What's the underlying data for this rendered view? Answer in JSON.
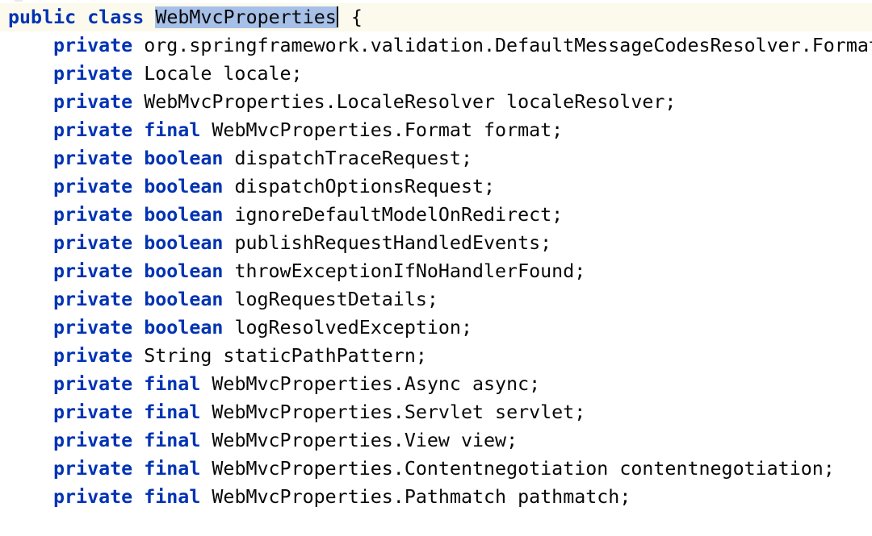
{
  "editor": {
    "class_decl": {
      "modifier": "public",
      "keyword": "class",
      "name": "WebMvcProperties",
      "brace": "{"
    },
    "fields": [
      {
        "access": "private",
        "qualifier": "",
        "decl": "org.springframework.validation.DefaultMessageCodesResolver.Format"
      },
      {
        "access": "private",
        "qualifier": "",
        "decl": "Locale locale;"
      },
      {
        "access": "private",
        "qualifier": "",
        "decl": "WebMvcProperties.LocaleResolver localeResolver;"
      },
      {
        "access": "private",
        "qualifier": "final",
        "decl": "WebMvcProperties.Format format;"
      },
      {
        "access": "private",
        "qualifier": "boolean",
        "decl": "dispatchTraceRequest;"
      },
      {
        "access": "private",
        "qualifier": "boolean",
        "decl": "dispatchOptionsRequest;"
      },
      {
        "access": "private",
        "qualifier": "boolean",
        "decl": "ignoreDefaultModelOnRedirect;"
      },
      {
        "access": "private",
        "qualifier": "boolean",
        "decl": "publishRequestHandledEvents;"
      },
      {
        "access": "private",
        "qualifier": "boolean",
        "decl": "throwExceptionIfNoHandlerFound;"
      },
      {
        "access": "private",
        "qualifier": "boolean",
        "decl": "logRequestDetails;"
      },
      {
        "access": "private",
        "qualifier": "boolean",
        "decl": "logResolvedException;"
      },
      {
        "access": "private",
        "qualifier": "",
        "decl": "String staticPathPattern;"
      },
      {
        "access": "private",
        "qualifier": "final",
        "decl": "WebMvcProperties.Async async;"
      },
      {
        "access": "private",
        "qualifier": "final",
        "decl": "WebMvcProperties.Servlet servlet;"
      },
      {
        "access": "private",
        "qualifier": "final",
        "decl": "WebMvcProperties.View view;"
      },
      {
        "access": "private",
        "qualifier": "final",
        "decl": "WebMvcProperties.Contentnegotiation contentnegotiation;"
      },
      {
        "access": "private",
        "qualifier": "final",
        "decl": "WebMvcProperties.Pathmatch pathmatch;"
      }
    ]
  },
  "colors": {
    "keyword": "#0033b3",
    "text": "#080808",
    "selection": "#a6c0e8",
    "current_line": "#fcfaed"
  }
}
